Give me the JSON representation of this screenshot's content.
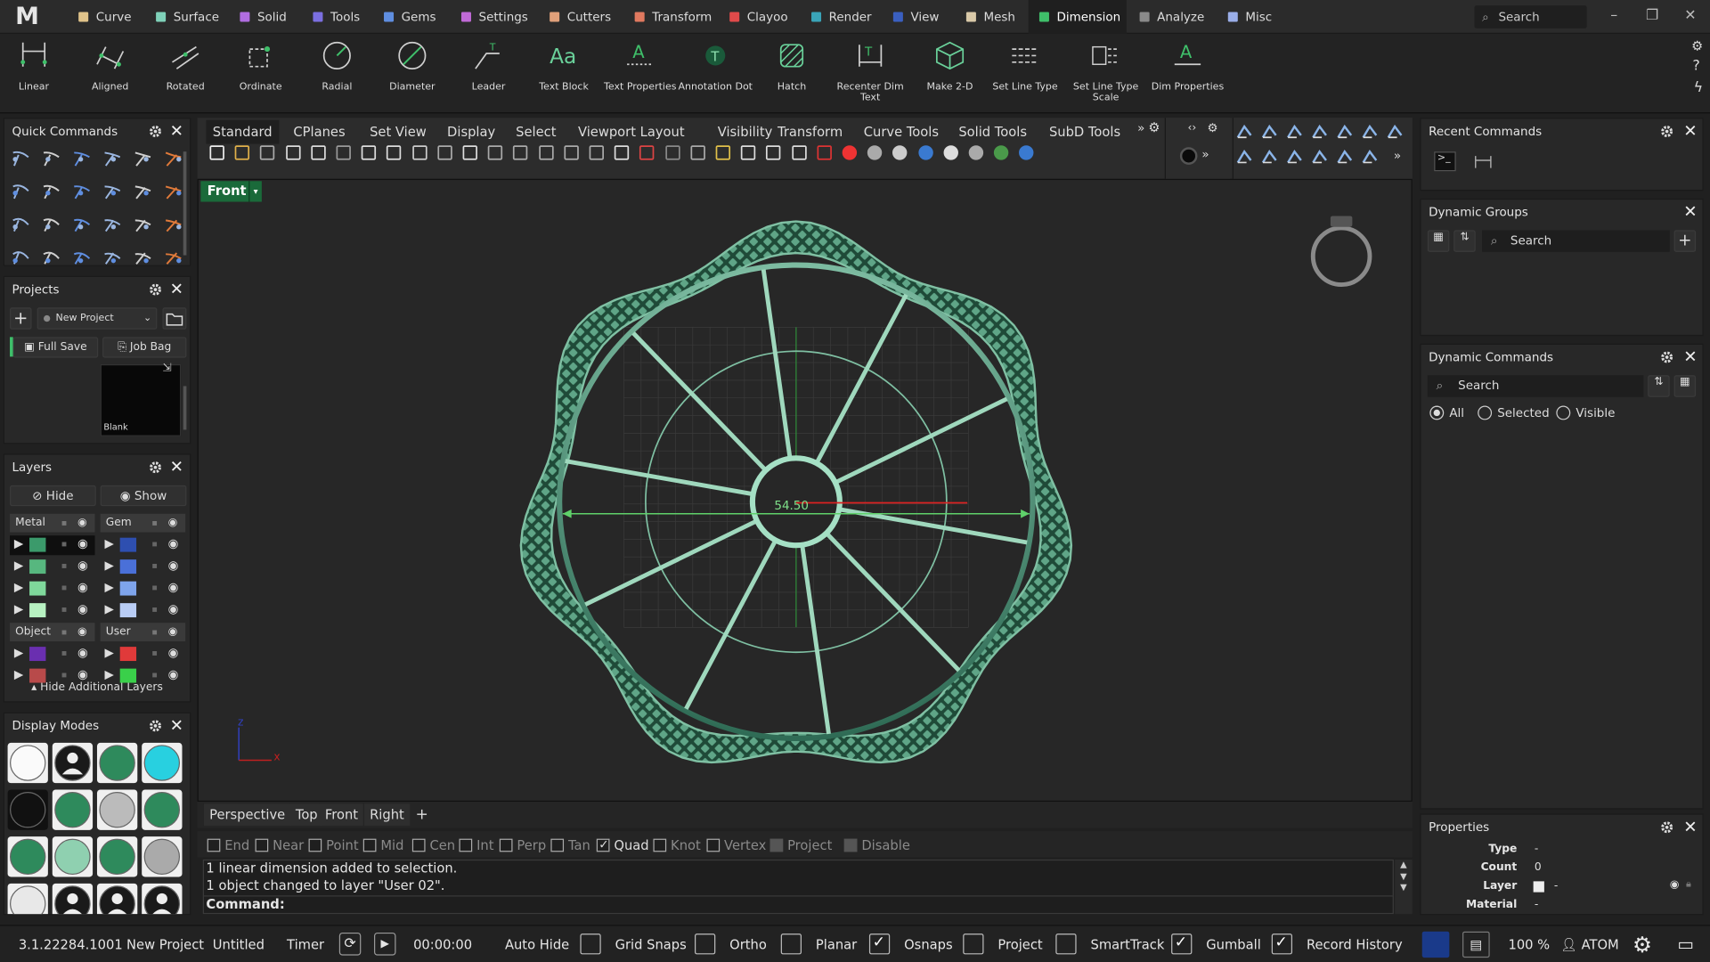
{
  "app": {
    "logo": "M"
  },
  "menu": {
    "items": [
      {
        "label": "Curve",
        "color": "#e0c38a"
      },
      {
        "label": "Surface",
        "color": "#7fd1b9"
      },
      {
        "label": "Solid",
        "color": "#b06de0"
      },
      {
        "label": "Tools",
        "color": "#7b6fe0"
      },
      {
        "label": "Gems",
        "color": "#5f8ee0"
      },
      {
        "label": "Settings",
        "color": "#c06ad6"
      },
      {
        "label": "Cutters",
        "color": "#e0a07a"
      },
      {
        "label": "Transform",
        "color": "#e0795f"
      },
      {
        "label": "Clayoo",
        "color": "#e04a4a"
      },
      {
        "label": "Render",
        "color": "#3aa4b8"
      },
      {
        "label": "View",
        "color": "#3a5fc0"
      },
      {
        "label": "Mesh",
        "color": "#d9c9a8"
      },
      {
        "label": "Dimension",
        "color": "#3fbf6a"
      },
      {
        "label": "Analyze",
        "color": "#8a8a8a"
      },
      {
        "label": "Misc",
        "color": "#9aaee8"
      }
    ],
    "active": "Dimension",
    "search_placeholder": "Search"
  },
  "ribbon": {
    "tools": [
      "Linear",
      "Aligned",
      "Rotated",
      "Ordinate",
      "Radial",
      "Diameter",
      "Leader",
      "Text Block",
      "Text Properties",
      "Annotation Dot",
      "Hatch",
      "Recenter Dim Text",
      "Make 2-D",
      "Set Line Type",
      "Set Line Type Scale",
      "Dim Properties"
    ]
  },
  "quick_commands": {
    "title": "Quick Commands"
  },
  "projects": {
    "title": "Projects",
    "project_name": "New Project",
    "full_save": "Full Save",
    "job_bag": "Job Bag",
    "thumb_label": "Blank"
  },
  "layers": {
    "title": "Layers",
    "hide": "Hide",
    "show": "Show",
    "groups": [
      "Metal",
      "Gem",
      "Object",
      "User"
    ],
    "hide_additional": "Hide Additional Layers",
    "metal_colors": [
      "#3b9a6b",
      "#57b77f",
      "#7fd89b",
      "#b8f2c2"
    ],
    "gem_colors": [
      "#2e4fb0",
      "#4a70d8",
      "#7ea4ec",
      "#b9cdf5"
    ],
    "object_colors": [
      "#6a2fb0",
      "#b84a4a"
    ],
    "user_colors": [
      "#e03a3a",
      "#3ad04a"
    ]
  },
  "display_modes": {
    "title": "Display Modes"
  },
  "viewport_toolbar": {
    "tabs": [
      "Standard",
      "CPlanes",
      "Set View",
      "Display",
      "Select",
      "Viewport Layout",
      "Visibility",
      "Transform",
      "Curve Tools",
      "Solid Tools",
      "SubD Tools"
    ],
    "active": "Standard"
  },
  "viewport": {
    "name": "Front",
    "dimension_label": "54.50",
    "axis_x": "x",
    "axis_y": "z"
  },
  "viewport_tabs": [
    "Perspective",
    "Top",
    "Front",
    "Right",
    "+"
  ],
  "osnaps": [
    {
      "label": "End",
      "checked": false
    },
    {
      "label": "Near",
      "checked": false
    },
    {
      "label": "Point",
      "checked": false
    },
    {
      "label": "Mid",
      "checked": false
    },
    {
      "label": "Cen",
      "checked": false
    },
    {
      "label": "Int",
      "checked": false
    },
    {
      "label": "Perp",
      "checked": false
    },
    {
      "label": "Tan",
      "checked": false
    },
    {
      "label": "Quad",
      "checked": true
    },
    {
      "label": "Knot",
      "checked": false
    },
    {
      "label": "Vertex",
      "checked": false
    },
    {
      "label": "Project",
      "checked": false
    },
    {
      "label": "Disable",
      "checked": false
    }
  ],
  "command": {
    "history": [
      "1 linear dimension added to selection.",
      "1 object changed to layer \"User 02\"."
    ],
    "prompt": "Command:"
  },
  "status": {
    "version": "3.1.22284.1001",
    "project": "New Project",
    "file": "Untitled",
    "timer_label": "Timer",
    "timer": "00:00:00",
    "auto_hide": "Auto Hide",
    "toggles": [
      {
        "label": "Grid Snaps",
        "checked": false
      },
      {
        "label": "Ortho",
        "checked": false
      },
      {
        "label": "Planar",
        "checked": false
      },
      {
        "label": "Osnaps",
        "checked": true
      },
      {
        "label": "Project",
        "checked": false
      },
      {
        "label": "SmartTrack",
        "checked": false
      },
      {
        "label": "Gumball",
        "checked": true
      },
      {
        "label": "Record History",
        "checked": true
      }
    ],
    "zoom": "100 %",
    "user": "ATOM"
  },
  "right": {
    "recent": "Recent Commands",
    "groups": "Dynamic Groups",
    "groups_search": "Search",
    "commands": "Dynamic Commands",
    "commands_search": "Search",
    "radio": [
      "All",
      "Selected",
      "Visible"
    ],
    "radio_selected": "All",
    "properties": "Properties",
    "props": [
      {
        "k": "Type",
        "v": "-"
      },
      {
        "k": "Count",
        "v": "0"
      },
      {
        "k": "Layer",
        "v": "-"
      },
      {
        "k": "Material",
        "v": "-"
      }
    ]
  }
}
